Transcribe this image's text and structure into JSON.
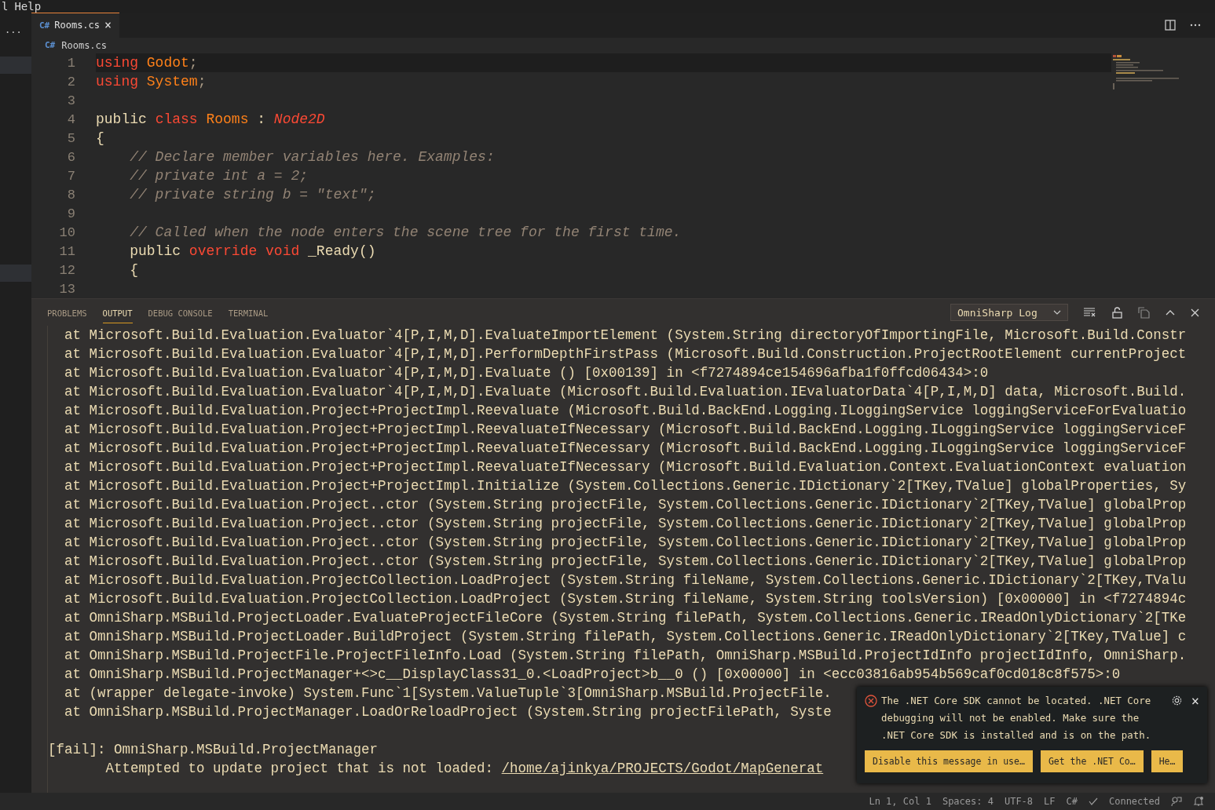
{
  "menu_bar": {
    "items": [
      "l",
      "Help"
    ]
  },
  "sidebar": {
    "more": "···"
  },
  "editor_tabs": [
    {
      "lang": "C#",
      "label": "Rooms.cs",
      "close": "×",
      "selected": true
    }
  ],
  "breadcrumb": {
    "lang": "C#",
    "file": "Rooms.cs"
  },
  "code": [
    {
      "number": "1",
      "current": true,
      "tokens": [
        {
          "kind": "keyword",
          "text": "using "
        },
        {
          "kind": "type",
          "text": "Godot"
        },
        {
          "kind": "punct",
          "text": ";"
        }
      ]
    },
    {
      "number": "2",
      "current": false,
      "tokens": [
        {
          "kind": "keyword",
          "text": "using "
        },
        {
          "kind": "type",
          "text": "System"
        },
        {
          "kind": "punct",
          "text": ";"
        }
      ]
    },
    {
      "number": "3",
      "current": false
    },
    {
      "number": "4",
      "current": false,
      "tokens": [
        {
          "kind": "plain",
          "text": "public "
        },
        {
          "kind": "keyword",
          "text": "class "
        },
        {
          "kind": "type",
          "text": "Rooms"
        },
        {
          "kind": "plain",
          "text": " : "
        },
        {
          "kind": "base",
          "text": "Node2D"
        }
      ]
    },
    {
      "number": "5",
      "current": false,
      "tokens": [
        {
          "kind": "plain",
          "text": "{"
        }
      ]
    },
    {
      "number": "6",
      "current": false,
      "tokens": [
        {
          "kind": "comment",
          "text": "    // Declare member variables here. Examples:"
        }
      ]
    },
    {
      "number": "7",
      "current": false,
      "tokens": [
        {
          "kind": "comment",
          "text": "    // private int a = 2;"
        }
      ]
    },
    {
      "number": "8",
      "current": false,
      "tokens": [
        {
          "kind": "comment",
          "text": "    // private string b = \"text\";"
        }
      ]
    },
    {
      "number": "9",
      "current": false
    },
    {
      "number": "10",
      "current": false,
      "tokens": [
        {
          "kind": "comment",
          "text": "    // Called when the node enters the scene tree for the first time."
        }
      ]
    },
    {
      "number": "11",
      "current": false,
      "tokens": [
        {
          "kind": "plain",
          "text": "    public "
        },
        {
          "kind": "keyword",
          "text": "override void"
        },
        {
          "kind": "plain",
          "text": " _Ready()"
        }
      ]
    },
    {
      "number": "12",
      "current": false,
      "tokens": [
        {
          "kind": "plain",
          "text": "    {"
        }
      ]
    },
    {
      "number": "13",
      "current": false
    }
  ],
  "panel": {
    "tabs": [
      {
        "label": "PROBLEMS",
        "selected": false
      },
      {
        "label": "OUTPUT",
        "selected": true
      },
      {
        "label": "DEBUG CONSOLE",
        "selected": false
      },
      {
        "label": "TERMINAL",
        "selected": false
      }
    ],
    "channel": "OmniSharp Log",
    "output": [
      {
        "kind": "trace",
        "text": "at Microsoft.Build.Evaluation.Evaluator`4[P,I,M,D].EvaluateImportElement (System.String directoryOfImportingFile, Microsoft.Build.Constr"
      },
      {
        "kind": "trace",
        "text": "at Microsoft.Build.Evaluation.Evaluator`4[P,I,M,D].PerformDepthFirstPass (Microsoft.Build.Construction.ProjectRootElement currentProject"
      },
      {
        "kind": "trace",
        "text": "at Microsoft.Build.Evaluation.Evaluator`4[P,I,M,D].Evaluate () [0x00139] in <f7274894ce154696afba1f0ffcd06434>:0"
      },
      {
        "kind": "trace",
        "text": "at Microsoft.Build.Evaluation.Evaluator`4[P,I,M,D].Evaluate (Microsoft.Build.Evaluation.IEvaluatorData`4[P,I,M,D] data, Microsoft.Build."
      },
      {
        "kind": "trace",
        "text": "at Microsoft.Build.Evaluation.Project+ProjectImpl.Reevaluate (Microsoft.Build.BackEnd.Logging.ILoggingService loggingServiceForEvaluatio"
      },
      {
        "kind": "trace",
        "text": "at Microsoft.Build.Evaluation.Project+ProjectImpl.ReevaluateIfNecessary (Microsoft.Build.BackEnd.Logging.ILoggingService loggingServiceF"
      },
      {
        "kind": "trace",
        "text": "at Microsoft.Build.Evaluation.Project+ProjectImpl.ReevaluateIfNecessary (Microsoft.Build.BackEnd.Logging.ILoggingService loggingServiceF"
      },
      {
        "kind": "trace",
        "text": "at Microsoft.Build.Evaluation.Project+ProjectImpl.ReevaluateIfNecessary (Microsoft.Build.Evaluation.Context.EvaluationContext evaluation"
      },
      {
        "kind": "trace",
        "text": "at Microsoft.Build.Evaluation.Project+ProjectImpl.Initialize (System.Collections.Generic.IDictionary`2[TKey,TValue] globalProperties, Sy"
      },
      {
        "kind": "trace",
        "text": "at Microsoft.Build.Evaluation.Project..ctor (System.String projectFile, System.Collections.Generic.IDictionary`2[TKey,TValue] globalProp"
      },
      {
        "kind": "trace",
        "text": "at Microsoft.Build.Evaluation.Project..ctor (System.String projectFile, System.Collections.Generic.IDictionary`2[TKey,TValue] globalProp"
      },
      {
        "kind": "trace",
        "text": "at Microsoft.Build.Evaluation.Project..ctor (System.String projectFile, System.Collections.Generic.IDictionary`2[TKey,TValue] globalProp"
      },
      {
        "kind": "trace",
        "text": "at Microsoft.Build.Evaluation.Project..ctor (System.String projectFile, System.Collections.Generic.IDictionary`2[TKey,TValue] globalProp"
      },
      {
        "kind": "trace",
        "text": "at Microsoft.Build.Evaluation.ProjectCollection.LoadProject (System.String fileName, System.Collections.Generic.IDictionary`2[TKey,TValu"
      },
      {
        "kind": "trace",
        "text": "at Microsoft.Build.Evaluation.ProjectCollection.LoadProject (System.String fileName, System.String toolsVersion) [0x00000] in <f7274894c"
      },
      {
        "kind": "trace",
        "text": "at OmniSharp.MSBuild.ProjectLoader.EvaluateProjectFileCore (System.String filePath, System.Collections.Generic.IReadOnlyDictionary`2[TKe"
      },
      {
        "kind": "trace",
        "text": "at OmniSharp.MSBuild.ProjectLoader.BuildProject (System.String filePath, System.Collections.Generic.IReadOnlyDictionary`2[TKey,TValue] c"
      },
      {
        "kind": "trace",
        "text": "at OmniSharp.MSBuild.ProjectFile.ProjectFileInfo.Load (System.String filePath, OmniSharp.MSBuild.ProjectIdInfo projectIdInfo, OmniSharp."
      },
      {
        "kind": "trace",
        "text": "at OmniSharp.MSBuild.ProjectManager+<>c__DisplayClass31_0.<LoadProject>b__0 () [0x00000] in <ecc03816ab954b569caf0cd018c8f575>:0"
      },
      {
        "kind": "trace",
        "text": "at (wrapper delegate-invoke) System.Func`1[System.ValueTuple`3[OmniSharp.MSBuild.ProjectFile."
      },
      {
        "kind": "trace",
        "text": "at OmniSharp.MSBuild.ProjectManager.LoadOrReloadProject (System.String projectFilePath, Syste"
      },
      {
        "kind": "blank"
      },
      {
        "kind": "fail",
        "text": "[fail]: OmniSharp.MSBuild.ProjectManager"
      },
      {
        "kind": "message",
        "text": "       Attempted to update project that is not loaded: ",
        "link": "/home/ajinkya/PROJECTS/Godot/MapGenerat"
      }
    ]
  },
  "notification": {
    "message": "The .NET Core SDK cannot be located. .NET Core debugging will not be enabled. Make sure the .NET Core SDK is installed and is on the path.",
    "close": "×",
    "buttons": [
      "Disable this message in use…",
      "Get the .NET Co…",
      "He…"
    ]
  },
  "status_bar": {
    "position": "Ln 1, Col 1",
    "spaces": "Spaces: 4",
    "encoding": "UTF-8",
    "eol": "LF",
    "language": "C#",
    "connection": "Connected"
  }
}
